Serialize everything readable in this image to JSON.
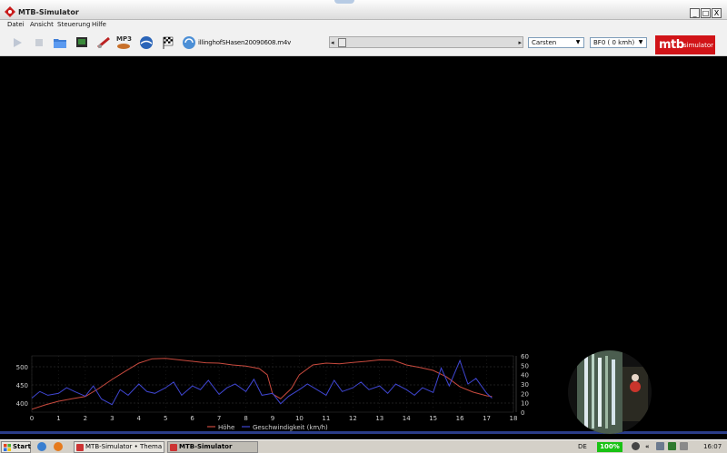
{
  "window": {
    "title": "MTB-Simulator",
    "minimize": "_",
    "restore": "□",
    "close": "X"
  },
  "menu": [
    "Datei",
    "Ansicht",
    "Steuerung",
    "Hilfe"
  ],
  "toolbar": {
    "icons": [
      "play-icon",
      "stop-icon",
      "open-folder-icon",
      "display-icon",
      "bike-icon",
      "mp3-icon",
      "earth-icon",
      "checkered-flag-icon",
      "sync-icon"
    ],
    "mp3_label": "MP3",
    "filename": "illinghofSHasen20090608.m4v",
    "progress": 0.02,
    "rider_select": "Carsten",
    "speed_select": "BF0 ( 0 kmh)",
    "logo_mtb": "mtb",
    "logo_sim": "simulator"
  },
  "colors": {
    "hoehe": "#c94a3e",
    "speed": "#3f46d2",
    "brand": "#d11418"
  },
  "chart_data": {
    "type": "line",
    "x_ticks": [
      0,
      1,
      2,
      3,
      4,
      5,
      6,
      7,
      8,
      9,
      10,
      11,
      12,
      13,
      14,
      15,
      16,
      17,
      18
    ],
    "xlim": [
      0,
      18
    ],
    "y_left_ticks": [
      400,
      450,
      500
    ],
    "ylim_left": [
      375,
      530
    ],
    "y_right_ticks": [
      0,
      10,
      20,
      30,
      40,
      50,
      60
    ],
    "ylim_right": [
      0,
      60
    ],
    "grid": true,
    "legend": "bottom-center",
    "series": [
      {
        "name": "Höhe",
        "axis": "left",
        "color": "#c94a3e",
        "x": [
          0,
          0.5,
          1,
          1.5,
          2,
          2.5,
          3,
          3.5,
          4,
          4.5,
          5,
          5.5,
          6,
          6.5,
          7,
          7.5,
          8,
          8.5,
          8.8,
          9,
          9.3,
          9.7,
          10,
          10.5,
          11,
          11.5,
          12,
          12.5,
          13,
          13.5,
          14,
          14.5,
          15,
          15.5,
          16,
          16.5,
          17,
          17.2
        ],
        "values": [
          383,
          395,
          405,
          412,
          418,
          440,
          465,
          488,
          510,
          522,
          523,
          519,
          515,
          511,
          510,
          505,
          502,
          495,
          478,
          425,
          412,
          440,
          478,
          505,
          510,
          508,
          512,
          515,
          519,
          518,
          505,
          498,
          490,
          472,
          445,
          430,
          420,
          418
        ]
      },
      {
        "name": "Geschwindigkeit (km/h)",
        "axis": "right",
        "color": "#3f46d2",
        "x": [
          0,
          0.3,
          0.6,
          1,
          1.3,
          1.6,
          2,
          2.3,
          2.6,
          3,
          3.3,
          3.6,
          4,
          4.3,
          4.6,
          5,
          5.3,
          5.6,
          6,
          6.3,
          6.6,
          7,
          7.3,
          7.6,
          8,
          8.3,
          8.6,
          9,
          9.3,
          9.6,
          10,
          10.3,
          10.6,
          11,
          11.3,
          11.6,
          12,
          12.3,
          12.6,
          13,
          13.3,
          13.6,
          14,
          14.3,
          14.6,
          15,
          15.3,
          15.6,
          16,
          16.3,
          16.6,
          17,
          17.2
        ],
        "values": [
          15,
          22,
          18,
          20,
          26,
          22,
          17,
          28,
          14,
          8,
          24,
          18,
          30,
          22,
          20,
          26,
          32,
          18,
          28,
          24,
          34,
          19,
          26,
          30,
          22,
          35,
          18,
          20,
          9,
          17,
          24,
          30,
          25,
          18,
          34,
          22,
          26,
          32,
          24,
          28,
          20,
          30,
          24,
          18,
          26,
          21,
          47,
          28,
          55,
          30,
          36,
          20,
          15
        ]
      }
    ]
  },
  "taskbar": {
    "start": "Start",
    "tasks": [
      "MTB-Simulator • Thema a...",
      "MTB-Simulator"
    ],
    "lang": "DE",
    "battery": "100%",
    "clock": "16:07",
    "chevron": "«"
  }
}
